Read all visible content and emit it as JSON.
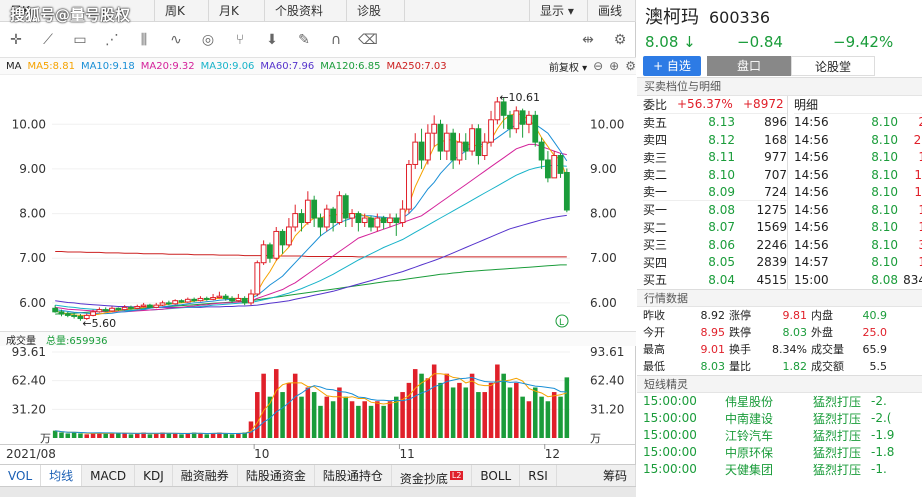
{
  "watermark": "搜狐号@量号股权",
  "tabs": [
    "日K",
    "周K",
    "月K",
    "个股资料",
    "诊股",
    "显示 ▾",
    "画线"
  ],
  "toolbar_icons": [
    "crosshair-icon",
    "line-icon",
    "rect-icon",
    "fan-icon",
    "channel-icon",
    "wave-icon",
    "cycle-icon",
    "fork-icon",
    "arrow-down-icon",
    "pen-icon",
    "magnet-icon",
    "eraser-icon",
    "split-icon",
    "settings-icon"
  ],
  "ma": {
    "label": "MA",
    "items": [
      {
        "t": "MA5:8.81",
        "c": "#f5a200"
      },
      {
        "t": "MA10:9.18",
        "c": "#1a8fd6"
      },
      {
        "t": "MA20:9.32",
        "c": "#d4229a"
      },
      {
        "t": "MA30:9.06",
        "c": "#17b3c9"
      },
      {
        "t": "MA60:7.96",
        "c": "#5533cc"
      },
      {
        "t": "MA120:6.85",
        "c": "#1a9c3a"
      },
      {
        "t": "MA250:7.03",
        "c": "#cc2020"
      }
    ],
    "adjust": "前复权 ▾"
  },
  "chart_data": {
    "type": "candlestick",
    "yticks": [
      "10.00",
      "9.00",
      "8.00",
      "7.00",
      "6.00"
    ],
    "high_label": "←10.61",
    "low_label": "←5.60",
    "candles": [
      [
        5.88,
        5.8,
        5.95,
        5.78
      ],
      [
        5.8,
        5.75,
        5.85,
        5.7
      ],
      [
        5.75,
        5.72,
        5.8,
        5.68
      ],
      [
        5.72,
        5.7,
        5.78,
        5.65
      ],
      [
        5.7,
        5.65,
        5.75,
        5.6
      ],
      [
        5.65,
        5.72,
        5.76,
        5.62
      ],
      [
        5.72,
        5.8,
        5.85,
        5.7
      ],
      [
        5.8,
        5.85,
        5.9,
        5.78
      ],
      [
        5.85,
        5.82,
        5.9,
        5.8
      ],
      [
        5.82,
        5.88,
        5.92,
        5.8
      ],
      [
        5.88,
        5.85,
        5.9,
        5.82
      ],
      [
        5.85,
        5.9,
        5.95,
        5.83
      ],
      [
        5.9,
        5.88,
        5.94,
        5.85
      ],
      [
        5.88,
        5.92,
        5.96,
        5.86
      ],
      [
        5.92,
        5.95,
        6.0,
        5.9
      ],
      [
        5.95,
        5.9,
        5.98,
        5.88
      ],
      [
        5.9,
        5.95,
        6.0,
        5.88
      ],
      [
        5.95,
        6.0,
        6.05,
        5.93
      ],
      [
        6.0,
        5.98,
        6.05,
        5.95
      ],
      [
        5.98,
        6.05,
        6.08,
        5.96
      ],
      [
        6.05,
        6.02,
        6.08,
        6.0
      ],
      [
        6.02,
        6.08,
        6.12,
        6.0
      ],
      [
        6.08,
        6.05,
        6.12,
        6.02
      ],
      [
        6.05,
        6.1,
        6.15,
        6.03
      ],
      [
        6.1,
        6.08,
        6.14,
        6.05
      ],
      [
        6.08,
        6.12,
        6.2,
        6.06
      ],
      [
        6.12,
        6.15,
        6.25,
        6.1
      ],
      [
        6.15,
        6.1,
        6.2,
        6.05
      ],
      [
        6.1,
        6.05,
        6.15,
        6.0
      ],
      [
        6.05,
        6.1,
        6.2,
        6.02
      ],
      [
        6.1,
        6.0,
        6.15,
        5.95
      ],
      [
        6.0,
        6.2,
        6.3,
        5.95
      ],
      [
        6.2,
        6.9,
        6.95,
        6.15
      ],
      [
        6.9,
        7.3,
        7.4,
        6.85
      ],
      [
        7.3,
        7.0,
        7.35,
        6.9
      ],
      [
        7.0,
        7.6,
        7.7,
        6.95
      ],
      [
        7.6,
        7.3,
        7.65,
        7.1
      ],
      [
        7.3,
        7.7,
        7.9,
        7.25
      ],
      [
        7.7,
        8.0,
        8.2,
        7.6
      ],
      [
        8.0,
        7.8,
        8.1,
        7.6
      ],
      [
        7.8,
        8.3,
        8.5,
        7.75
      ],
      [
        8.3,
        7.9,
        8.4,
        7.7
      ],
      [
        7.9,
        7.7,
        8.0,
        7.5
      ],
      [
        7.7,
        8.1,
        8.2,
        7.6
      ],
      [
        8.1,
        7.8,
        8.15,
        7.6
      ],
      [
        7.8,
        8.4,
        8.5,
        7.75
      ],
      [
        8.4,
        7.9,
        8.45,
        7.7
      ],
      [
        7.9,
        8.0,
        8.1,
        7.7
      ],
      [
        8.0,
        7.8,
        8.05,
        7.6
      ],
      [
        7.8,
        7.9,
        8.0,
        7.7
      ],
      [
        7.9,
        7.7,
        7.95,
        7.6
      ],
      [
        7.7,
        7.9,
        8.0,
        7.6
      ],
      [
        7.9,
        7.8,
        7.95,
        7.65
      ],
      [
        7.8,
        7.9,
        8.0,
        7.7
      ],
      [
        7.9,
        7.8,
        8.0,
        7.5
      ],
      [
        7.8,
        8.1,
        8.3,
        7.7
      ],
      [
        8.1,
        9.1,
        9.2,
        8.0
      ],
      [
        9.1,
        9.6,
        9.8,
        9.0
      ],
      [
        9.6,
        9.2,
        9.9,
        9.0
      ],
      [
        9.2,
        9.8,
        10.0,
        9.1
      ],
      [
        9.8,
        10.0,
        10.2,
        9.5
      ],
      [
        10.0,
        9.4,
        10.1,
        9.2
      ],
      [
        9.4,
        9.8,
        10.0,
        9.2
      ],
      [
        9.8,
        9.2,
        9.9,
        9.0
      ],
      [
        9.2,
        9.6,
        9.8,
        9.1
      ],
      [
        9.6,
        9.4,
        9.8,
        9.2
      ],
      [
        9.4,
        9.9,
        10.0,
        9.3
      ],
      [
        9.9,
        9.3,
        10.0,
        9.1
      ],
      [
        9.3,
        9.6,
        9.8,
        9.2
      ],
      [
        9.6,
        10.1,
        10.3,
        9.5
      ],
      [
        10.1,
        10.5,
        10.61,
        10.0
      ],
      [
        10.5,
        10.2,
        10.6,
        9.9
      ],
      [
        10.2,
        9.9,
        10.3,
        9.7
      ],
      [
        9.9,
        10.3,
        10.4,
        9.8
      ],
      [
        10.3,
        10.0,
        10.35,
        9.7
      ],
      [
        10.0,
        10.2,
        10.3,
        9.8
      ],
      [
        10.2,
        9.6,
        10.3,
        9.5
      ],
      [
        9.6,
        9.2,
        9.7,
        9.0
      ],
      [
        9.2,
        8.8,
        9.4,
        8.7
      ],
      [
        8.8,
        9.3,
        9.4,
        8.8
      ],
      [
        9.3,
        8.9,
        9.35,
        8.8
      ],
      [
        8.92,
        8.08,
        9.01,
        8.03
      ]
    ],
    "ma5": [
      5.82,
      5.78,
      5.75,
      5.73,
      5.72,
      5.72,
      5.73,
      5.75,
      5.78,
      5.8,
      5.83,
      5.85,
      5.87,
      5.88,
      5.9,
      5.92,
      5.93,
      5.95,
      5.97,
      5.99,
      6.0,
      6.02,
      6.04,
      6.06,
      6.07,
      6.09,
      6.1,
      6.1,
      6.1,
      6.1,
      6.08,
      6.1,
      6.25,
      6.5,
      6.7,
      6.95,
      7.1,
      7.25,
      7.5,
      7.65,
      7.8,
      7.9,
      7.9,
      7.95,
      7.95,
      8.0,
      8.0,
      8.0,
      8.0,
      7.95,
      7.9,
      7.85,
      7.85,
      7.85,
      7.85,
      7.9,
      8.2,
      8.6,
      8.9,
      9.2,
      9.5,
      9.6,
      9.65,
      9.65,
      9.6,
      9.55,
      9.55,
      9.5,
      9.5,
      9.65,
      9.9,
      10.1,
      10.2,
      10.25,
      10.2,
      10.1,
      9.95,
      9.7,
      9.5,
      9.3,
      9.2,
      8.81
    ],
    "ma10": [
      5.85,
      5.83,
      5.81,
      5.79,
      5.78,
      5.77,
      5.76,
      5.76,
      5.76,
      5.77,
      5.79,
      5.8,
      5.82,
      5.84,
      5.86,
      5.88,
      5.9,
      5.91,
      5.93,
      5.95,
      5.96,
      5.98,
      6.0,
      6.01,
      6.03,
      6.04,
      6.06,
      6.07,
      6.08,
      6.09,
      6.09,
      6.1,
      6.17,
      6.28,
      6.4,
      6.5,
      6.6,
      6.75,
      6.9,
      7.05,
      7.2,
      7.35,
      7.5,
      7.6,
      7.7,
      7.8,
      7.85,
      7.9,
      7.95,
      7.95,
      7.95,
      7.93,
      7.92,
      7.9,
      7.9,
      7.9,
      8.0,
      8.15,
      8.35,
      8.55,
      8.7,
      8.9,
      9.05,
      9.2,
      9.3,
      9.4,
      9.5,
      9.55,
      9.55,
      9.6,
      9.7,
      9.8,
      9.9,
      10.0,
      10.05,
      10.05,
      10.0,
      9.9,
      9.8,
      9.6,
      9.4,
      9.18
    ],
    "ma20": [
      5.9,
      5.88,
      5.86,
      5.85,
      5.84,
      5.83,
      5.82,
      5.81,
      5.8,
      5.8,
      5.8,
      5.8,
      5.81,
      5.82,
      5.83,
      5.84,
      5.85,
      5.86,
      5.88,
      5.89,
      5.9,
      5.92,
      5.93,
      5.95,
      5.96,
      5.98,
      5.99,
      6.0,
      6.01,
      6.02,
      6.03,
      6.05,
      6.1,
      6.15,
      6.2,
      6.25,
      6.3,
      6.38,
      6.45,
      6.55,
      6.65,
      6.75,
      6.85,
      6.95,
      7.05,
      7.15,
      7.25,
      7.35,
      7.45,
      7.5,
      7.55,
      7.6,
      7.65,
      7.7,
      7.75,
      7.8,
      7.85,
      7.9,
      7.95,
      8.05,
      8.15,
      8.25,
      8.35,
      8.45,
      8.55,
      8.65,
      8.75,
      8.85,
      8.95,
      9.05,
      9.15,
      9.25,
      9.35,
      9.45,
      9.5,
      9.55,
      9.55,
      9.5,
      9.45,
      9.4,
      9.35,
      9.32
    ],
    "ma30": [
      5.95,
      5.93,
      5.91,
      5.9,
      5.88,
      5.87,
      5.86,
      5.85,
      5.84,
      5.84,
      5.83,
      5.83,
      5.83,
      5.83,
      5.84,
      5.84,
      5.85,
      5.86,
      5.87,
      5.88,
      5.89,
      5.9,
      5.91,
      5.92,
      5.93,
      5.95,
      5.96,
      5.97,
      5.98,
      5.99,
      6.0,
      6.01,
      6.04,
      6.07,
      6.1,
      6.14,
      6.18,
      6.22,
      6.27,
      6.32,
      6.38,
      6.44,
      6.5,
      6.57,
      6.64,
      6.72,
      6.8,
      6.88,
      6.96,
      7.03,
      7.1,
      7.17,
      7.24,
      7.3,
      7.36,
      7.42,
      7.5,
      7.58,
      7.66,
      7.74,
      7.82,
      7.9,
      7.98,
      8.06,
      8.14,
      8.22,
      8.3,
      8.38,
      8.46,
      8.54,
      8.62,
      8.7,
      8.78,
      8.86,
      8.92,
      8.98,
      9.02,
      9.05,
      9.07,
      9.08,
      9.07,
      9.06
    ],
    "ma60": [
      6.05,
      6.03,
      6.01,
      6.0,
      5.98,
      5.97,
      5.96,
      5.95,
      5.94,
      5.93,
      5.92,
      5.92,
      5.91,
      5.91,
      5.9,
      5.9,
      5.9,
      5.9,
      5.9,
      5.9,
      5.9,
      5.9,
      5.9,
      5.9,
      5.91,
      5.91,
      5.91,
      5.92,
      5.92,
      5.93,
      5.93,
      5.94,
      5.95,
      5.97,
      5.99,
      6.01,
      6.03,
      6.05,
      6.08,
      6.11,
      6.14,
      6.17,
      6.2,
      6.23,
      6.26,
      6.3,
      6.34,
      6.38,
      6.42,
      6.46,
      6.5,
      6.54,
      6.58,
      6.62,
      6.66,
      6.7,
      6.75,
      6.8,
      6.85,
      6.9,
      6.95,
      7.0,
      7.06,
      7.12,
      7.18,
      7.24,
      7.3,
      7.36,
      7.42,
      7.48,
      7.54,
      7.6,
      7.66,
      7.7,
      7.74,
      7.78,
      7.82,
      7.86,
      7.89,
      7.92,
      7.94,
      7.96
    ],
    "ma120": [
      5.75,
      5.76,
      5.77,
      5.77,
      5.78,
      5.79,
      5.8,
      5.81,
      5.82,
      5.83,
      5.84,
      5.85,
      5.86,
      5.87,
      5.88,
      5.89,
      5.9,
      5.91,
      5.92,
      5.93,
      5.94,
      5.95,
      5.96,
      5.97,
      5.98,
      5.99,
      6.0,
      6.01,
      6.02,
      6.03,
      6.04,
      6.05,
      6.07,
      6.09,
      6.11,
      6.13,
      6.15,
      6.17,
      6.19,
      6.21,
      6.23,
      6.25,
      6.27,
      6.29,
      6.31,
      6.33,
      6.35,
      6.37,
      6.39,
      6.41,
      6.43,
      6.45,
      6.47,
      6.49,
      6.5,
      6.52,
      6.54,
      6.56,
      6.58,
      6.6,
      6.62,
      6.64,
      6.65,
      6.67,
      6.68,
      6.7,
      6.71,
      6.72,
      6.73,
      6.74,
      6.75,
      6.76,
      6.77,
      6.78,
      6.79,
      6.8,
      6.81,
      6.82,
      6.83,
      6.84,
      6.85,
      6.85
    ],
    "ma250": [
      7.15,
      7.15,
      7.14,
      7.14,
      7.14,
      7.13,
      7.13,
      7.13,
      7.12,
      7.12,
      7.12,
      7.11,
      7.11,
      7.11,
      7.1,
      7.1,
      7.1,
      7.1,
      7.09,
      7.09,
      7.09,
      7.09,
      7.08,
      7.08,
      7.08,
      7.08,
      7.07,
      7.07,
      7.07,
      7.07,
      7.06,
      7.06,
      7.06,
      7.06,
      7.06,
      7.05,
      7.05,
      7.05,
      7.05,
      7.05,
      7.04,
      7.04,
      7.04,
      7.04,
      7.04,
      7.04,
      7.04,
      7.04,
      7.03,
      7.03,
      7.03,
      7.03,
      7.03,
      7.03,
      7.03,
      7.03,
      7.03,
      7.03,
      7.03,
      7.03,
      7.03,
      7.03,
      7.03,
      7.03,
      7.03,
      7.03,
      7.03,
      7.03,
      7.03,
      7.03,
      7.03,
      7.03,
      7.03,
      7.03,
      7.03,
      7.03,
      7.03,
      7.03,
      7.03,
      7.03,
      7.03,
      7.03
    ],
    "volumes": [
      8,
      6,
      5,
      6,
      5,
      4,
      5,
      6,
      5,
      5,
      6,
      5,
      4,
      5,
      6,
      4,
      5,
      6,
      5,
      5,
      4,
      5,
      6,
      5,
      4,
      5,
      6,
      5,
      4,
      5,
      6,
      18,
      50,
      70,
      45,
      75,
      50,
      60,
      70,
      45,
      55,
      50,
      35,
      45,
      40,
      55,
      45,
      40,
      35,
      40,
      35,
      40,
      35,
      40,
      45,
      50,
      60,
      75,
      70,
      65,
      80,
      60,
      70,
      55,
      60,
      55,
      70,
      50,
      50,
      60,
      80,
      70,
      55,
      60,
      45,
      40,
      55,
      45,
      40,
      50,
      45,
      66
    ],
    "vol_yticks": [
      "93.61",
      "62.40",
      "31.20",
      "万"
    ],
    "dates": [
      "2021/08",
      "10",
      "11",
      "12"
    ]
  },
  "vol": {
    "label": "成交量",
    "total": "总量:659936"
  },
  "bottom_tabs": [
    "VOL",
    "均线",
    "MACD",
    "KDJ",
    "融资融券",
    "陆股通资金",
    "陆股通持仓",
    "资金抄底",
    "BOLL",
    "RSI",
    "筹码"
  ],
  "badge": "L2",
  "stock": {
    "name": "澳柯玛",
    "code": "600336",
    "price": "8.08 ↓",
    "change": "−0.84",
    "pct": "−9.42%"
  },
  "buttons": {
    "add": "+ 自选",
    "pankou": "盘口",
    "lun": "论股堂"
  },
  "ob_title": "买卖档位与明细",
  "mingxi": "明细",
  "weibi": {
    "l": "委比",
    "v": "+56.37%",
    "d": "+8972"
  },
  "asks": [
    [
      "卖五",
      "8.13",
      "896"
    ],
    [
      "卖四",
      "8.12",
      "168"
    ],
    [
      "卖三",
      "8.11",
      "977"
    ],
    [
      "卖二",
      "8.10",
      "707"
    ],
    [
      "卖一",
      "8.09",
      "724"
    ]
  ],
  "bids": [
    [
      "买一",
      "8.08",
      "1275"
    ],
    [
      "买二",
      "8.07",
      "1569"
    ],
    [
      "买三",
      "8.06",
      "2246"
    ],
    [
      "买四",
      "8.05",
      "2839"
    ],
    [
      "买五",
      "8.04",
      "4515"
    ]
  ],
  "ticks": [
    [
      "14:56",
      "8.10",
      "2"
    ],
    [
      "14:56",
      "8.10",
      "2("
    ],
    [
      "14:56",
      "8.10",
      "1"
    ],
    [
      "14:56",
      "8.10",
      "1:"
    ],
    [
      "14:56",
      "8.10",
      "1:"
    ],
    [
      "14:56",
      "8.10",
      "1"
    ],
    [
      "14:56",
      "8.10",
      "1"
    ],
    [
      "14:56",
      "8.10",
      "3"
    ],
    [
      "14:57",
      "8.10",
      "1"
    ],
    [
      "15:00",
      "8.08",
      "834"
    ]
  ],
  "hq_title": "行情数据",
  "hq": [
    [
      "昨收",
      "8.92",
      "涨停",
      "9.81",
      "内盘",
      "40.9"
    ],
    [
      "今开",
      "8.95",
      "跌停",
      "8.03",
      "外盘",
      "25.0"
    ],
    [
      "最高",
      "9.01",
      "换手",
      "8.34%",
      "成交量",
      "65.9"
    ],
    [
      "最低",
      "8.03",
      "量比",
      "1.82",
      "成交额",
      "5.5"
    ]
  ],
  "dx_title": "短线精灵",
  "dx": [
    [
      "15:00:00",
      "伟星股份",
      "猛烈打压",
      "-2."
    ],
    [
      "15:00:00",
      "中南建设",
      "猛烈打压",
      "-2.("
    ],
    [
      "15:00:00",
      "江铃汽车",
      "猛烈打压",
      "-1.9"
    ],
    [
      "15:00:00",
      "中原环保",
      "猛烈打压",
      "-1.8"
    ],
    [
      "15:00:00",
      "天健集团",
      "猛烈打压",
      "-1."
    ]
  ]
}
